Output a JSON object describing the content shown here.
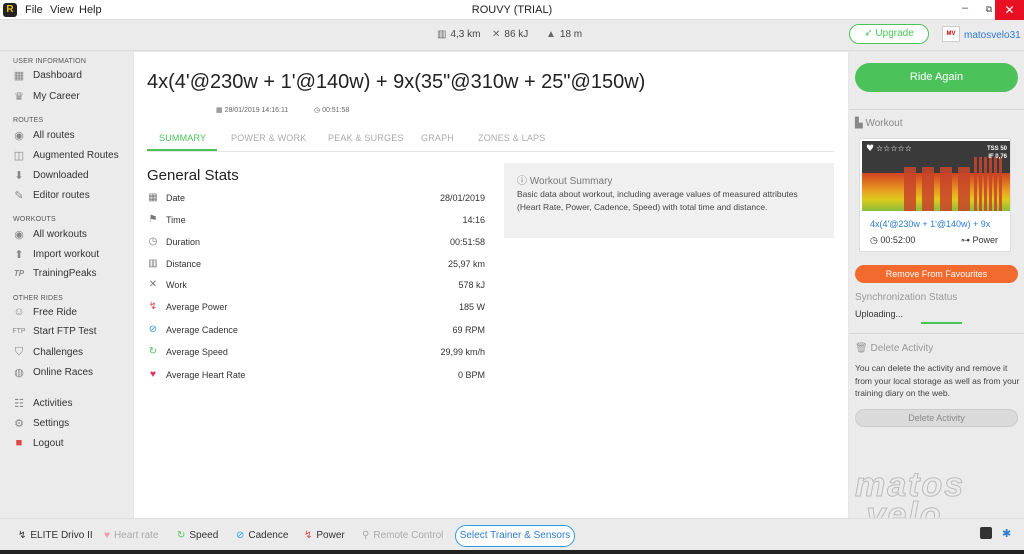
{
  "window": {
    "title": "ROUVY (TRIAL)",
    "menu": [
      "File",
      "View",
      "Help"
    ],
    "controls": {
      "minimize": "–",
      "restore": "⧉",
      "close": "✕"
    }
  },
  "topbar": {
    "distance": "4,3 km",
    "work": "86 kJ",
    "elevation": "18 m",
    "upgrade_label": "Upgrade",
    "username": "matosvelo31",
    "avatar_text": "MV"
  },
  "sidebar": {
    "sections": {
      "user": "USER INFORMATION",
      "routes": "ROUTES",
      "workouts": "WORKOUTS",
      "other": "OTHER RIDES"
    },
    "items": {
      "dashboard": "Dashboard",
      "career": "My Career",
      "all_routes": "All routes",
      "augmented": "Augmented Routes",
      "downloaded": "Downloaded",
      "editor": "Editor routes",
      "all_workouts": "All workouts",
      "import": "Import workout",
      "trainingpeaks": "TrainingPeaks",
      "free_ride": "Free Ride",
      "ftp_test": "Start FTP Test",
      "challenges": "Challenges",
      "online_races": "Online Races",
      "activities": "Activities",
      "settings": "Settings",
      "logout": "Logout"
    },
    "icon_labels": {
      "tp": "TP",
      "ftp": "FTP"
    }
  },
  "main": {
    "title": "4x(4'@230w + 1'@140w) + 9x(35\"@310w + 25\"@150w)",
    "datetime": "28/01/2019 14:16:11",
    "duration": "00:51:58",
    "tabs": [
      "SUMMARY",
      "POWER & WORK",
      "PEAK & SURGES",
      "GRAPH",
      "ZONES & LAPS"
    ],
    "general_stats_title": "General Stats",
    "stats": [
      {
        "label": "Date",
        "value": "28/01/2019"
      },
      {
        "label": "Time",
        "value": "14:16"
      },
      {
        "label": "Duration",
        "value": "00:51:58"
      },
      {
        "label": "Distance",
        "value": "25,97 km"
      },
      {
        "label": "Work",
        "value": "578 kJ"
      },
      {
        "label": "Average Power",
        "value": "185 W"
      },
      {
        "label": "Average Cadence",
        "value": "69 RPM"
      },
      {
        "label": "Average Speed",
        "value": "29,99 km/h"
      },
      {
        "label": "Average Heart Rate",
        "value": "0 BPM"
      }
    ],
    "summary": {
      "heading": "Workout Summary",
      "text": "Basic data about workout, including average values of measured attributes (Heart Rate, Power, Cadence, Speed) with total time and distance."
    }
  },
  "right": {
    "ride_again": "Ride Again",
    "workout_heading": "Workout",
    "card": {
      "tss": "TSS 50",
      "if": "IF 0,76",
      "rating_stars": 0,
      "name": "4x(4'@230w + 1'@140w) + 9x",
      "duration": "00:52:00",
      "type": "Power"
    },
    "remove_fav": "Remove From Favourites",
    "sync_heading": "Synchronization Status",
    "sync_status": "Uploading...",
    "delete_heading": "Delete Activity",
    "delete_text": "You can delete the activity and remove it from your local storage as well as from your training diary on the web.",
    "delete_button": "Delete Activity"
  },
  "bottombar": {
    "trainer": "ELITE Drivo II",
    "heart_rate": "Heart rate",
    "speed": "Speed",
    "cadence": "Cadence",
    "power": "Power",
    "remote": "Remote Control",
    "select_trainer": "Select Trainer & Sensors"
  },
  "watermark": "matos velo",
  "colors": {
    "accent_green": "#4cc35a",
    "accent_orange": "#f26a2e",
    "link_blue": "#2c7bd0"
  }
}
